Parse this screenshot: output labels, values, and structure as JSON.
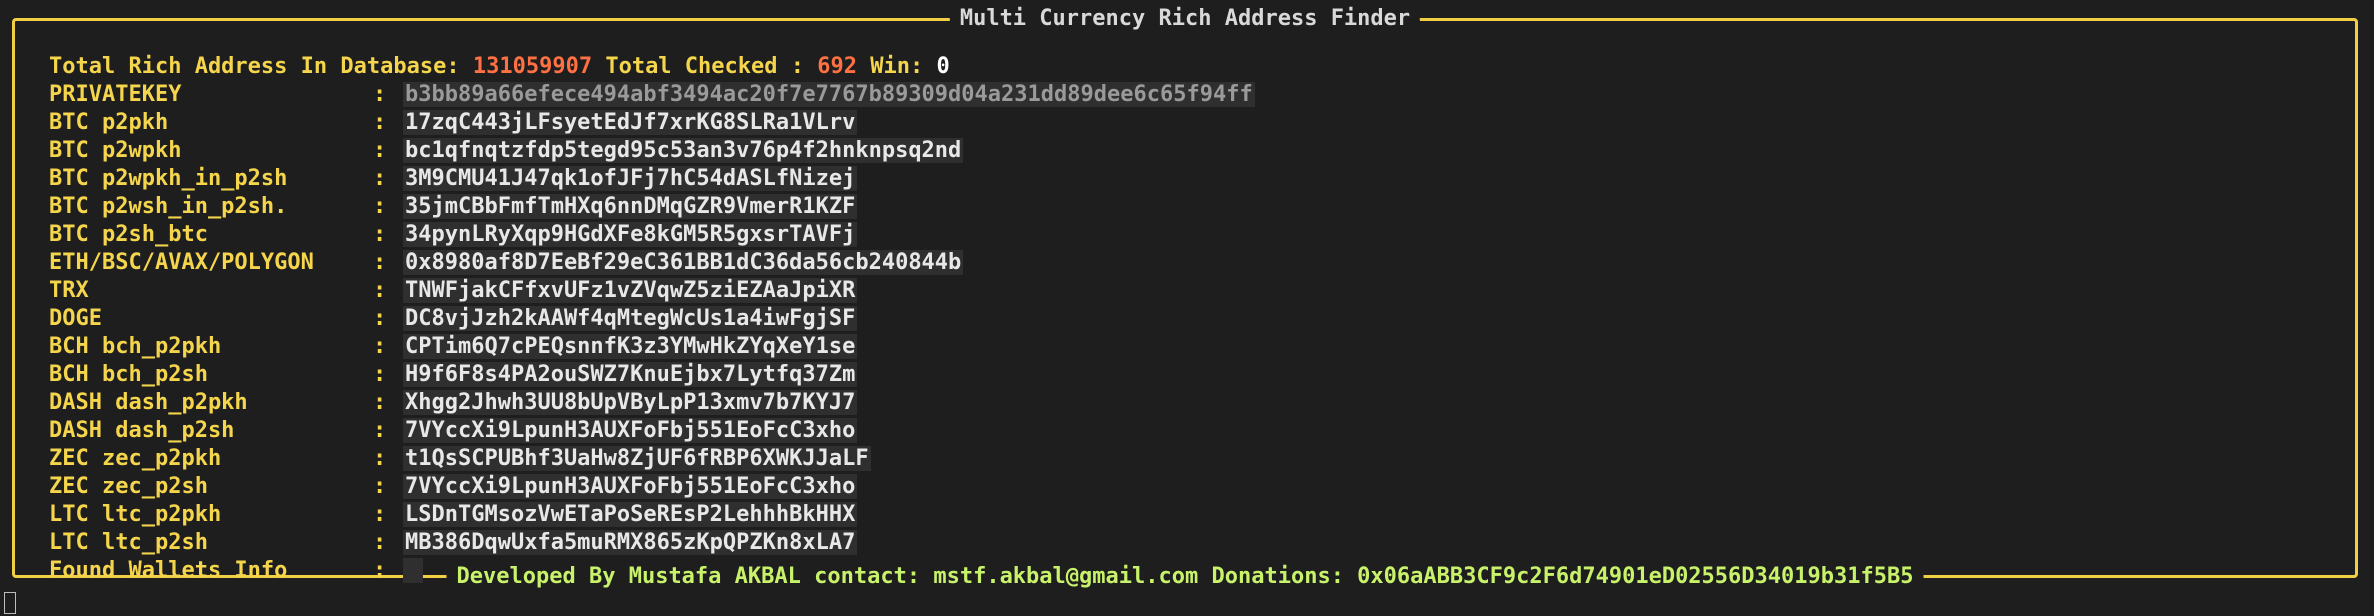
{
  "window": {
    "title": "Multi Currency Rich Address Finder",
    "footer": "Developed By Mustafa AKBAL contact: mstf.akbal@gmail.com  Donations: 0x06aABB3CF9c2F6d74901eD02556D34019b31f5B5"
  },
  "stats": {
    "total_label": "Total Rich Address In Database:",
    "total_value": "131059907",
    "checked_label": "Total Checked :",
    "checked_value": "692",
    "win_label": "Win:",
    "win_value": "0"
  },
  "rows": [
    {
      "label": "PRIVATEKEY",
      "value": "b3bb89a66efece494abf3494ac20f7e7767b89309d04a231dd89dee6c65f94ff"
    },
    {
      "label": "BTC p2pkh",
      "value": "17zqC443jLFsyetEdJf7xrKG8SLRa1VLrv"
    },
    {
      "label": "BTC p2wpkh",
      "value": "bc1qfnqtzfdp5tegd95c53an3v76p4f2hnknpsq2nd"
    },
    {
      "label": "BTC p2wpkh_in_p2sh",
      "value": "3M9CMU41J47qk1ofJFj7hC54dASLfNizej"
    },
    {
      "label": "BTC p2wsh_in_p2sh.",
      "value": "35jmCBbFmfTmHXq6nnDMqGZR9VmerR1KZF"
    },
    {
      "label": "BTC p2sh_btc",
      "value": "34pynLRyXqp9HGdXFe8kGM5R5gxsrTAVFj"
    },
    {
      "label": "ETH/BSC/AVAX/POLYGON",
      "value": "0x8980af8D7EeBf29eC361BB1dC36da56cb240844b"
    },
    {
      "label": "TRX",
      "value": "TNWFjakCFfxvUFz1vZVqwZ5ziEZAaJpiXR"
    },
    {
      "label": "DOGE",
      "value": "DC8vjJzh2kAAWf4qMtegWcUs1a4iwFgjSF"
    },
    {
      "label": "BCH bch_p2pkh",
      "value": "CPTim6Q7cPEQsnnfK3z3YMwHkZYqXeY1se"
    },
    {
      "label": "BCH bch_p2sh",
      "value": "H9f6F8s4PA2ouSWZ7KnuEjbx7Lytfq37Zm"
    },
    {
      "label": "DASH dash_p2pkh",
      "value": "Xhgg2Jhwh3UU8bUpVByLpP13xmv7b7KYJ7"
    },
    {
      "label": "DASH dash_p2sh",
      "value": "7VYccXi9LpunH3AUXFoFbj551EoFcC3xho"
    },
    {
      "label": "ZEC zec_p2pkh",
      "value": "t1QsSCPUBhf3UaHw8ZjUF6fRBP6XWKJJaLF"
    },
    {
      "label": "ZEC zec_p2sh",
      "value": "7VYccXi9LpunH3AUXFoFbj551EoFcC3xho"
    },
    {
      "label": "LTC ltc_p2pkh",
      "value": "LSDnTGMsozVwETaPoSeREsP2LehhhBkHHX"
    },
    {
      "label": "LTC ltc_p2sh",
      "value": "MB386DqwUxfa5muRMX865zKpQPZKn8xLA7"
    },
    {
      "label": "Found Wallets Info",
      "value": ""
    }
  ],
  "separator": ":"
}
